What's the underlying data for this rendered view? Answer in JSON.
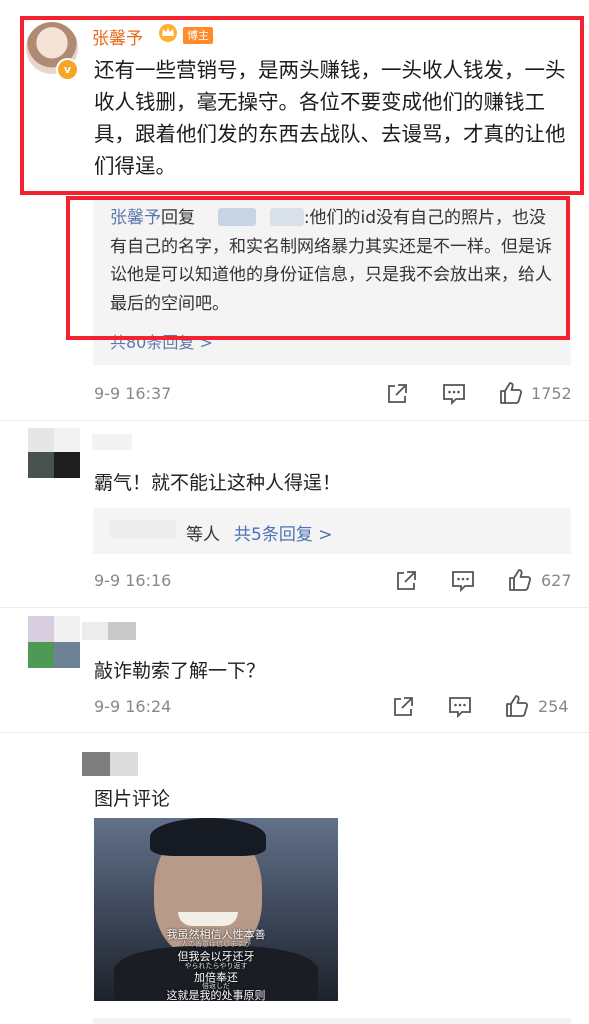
{
  "comment_main": {
    "author": "张馨予",
    "vip_label": "博主",
    "text": "还有一些营销号，是两头赚钱，一头收人钱发，一头收人钱删，毫无操守。各位不要变成他们的赚钱工具，跟着他们发的东西去战队、去谩骂，才真的让他们得逞。",
    "reply": {
      "author": "张馨予",
      "reply_word": "回复",
      "text": ":他们的id没有自己的照片，也没有自己的名字，和实名制网络暴力其实还是不一样。但是诉讼他是可以知道他的身份证信息，只是我不会放出来，给人最后的空间吧。",
      "more": "共80条回复 >"
    },
    "time": "9-9 16:37",
    "likes": "1752"
  },
  "comment_2": {
    "text": "霸气！就不能让这种人得逞！",
    "reply_prefix": "等人",
    "reply_link": "共5条回复",
    "reply_chevron": ">",
    "time": "9-9 16:16",
    "likes": "627"
  },
  "comment_3": {
    "text": "敲诈勒索了解一下？",
    "time": "9-9 16:24",
    "likes": "254"
  },
  "comment_4": {
    "text": "图片评论",
    "image": {
      "subtitles": [
        "我虽然相信人性本善",
        "但我会以牙还牙",
        "加倍奉还",
        "这就是我的处事原则"
      ],
      "subtitles_jp": [
        "人の善意は信じますが",
        "やられたらやり返す",
        "倍返しだ"
      ]
    }
  },
  "colors": {
    "highlight_border": "#f4212e",
    "author_orange": "#e86a16",
    "link_blue": "#4a72b8"
  }
}
